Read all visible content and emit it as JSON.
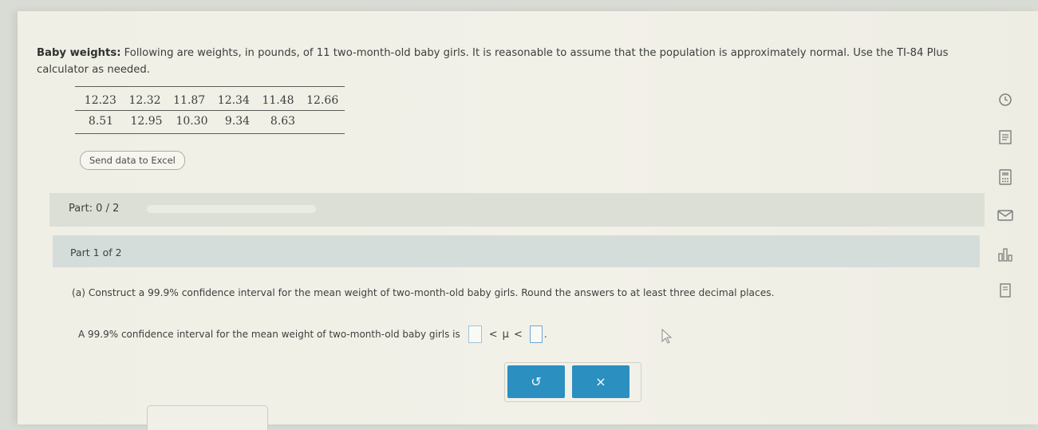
{
  "question": {
    "title": "Baby weights:",
    "body": " Following are weights, in pounds, of 11 two-month-old baby girls. It is reasonable to assume that the population is approximately normal. Use the TI-84 Plus calculator as needed."
  },
  "data_table": {
    "rows": [
      [
        "12.23",
        "12.32",
        "11.87",
        "12.34",
        "11.48",
        "12.66"
      ],
      [
        "8.51",
        "12.95",
        "10.30",
        "9.34",
        "8.63"
      ]
    ]
  },
  "excel_button": {
    "label": "Send data to Excel"
  },
  "parts": {
    "label": "Part: 0 / 2",
    "progress": 0
  },
  "part1": {
    "label": "Part 1 of 2"
  },
  "instruction": "(a) Construct a 99.9% confidence interval for the mean weight of two-month-old baby girls. Round the answers to at least three decimal places.",
  "answer": {
    "prefix": "A 99.9% confidence interval for the mean weight of two-month-old baby girls is",
    "lt1": "<",
    "mu": "μ",
    "lt2": "<",
    "suffix": "."
  },
  "buttons": {
    "undo": "↺",
    "clear": "×"
  },
  "colors": {
    "accent": "#2b8fc0",
    "progress": "#6aa5d3"
  },
  "icons": [
    "clock-icon",
    "list-icon",
    "calculator-icon",
    "mail-icon",
    "chart-icon",
    "book-icon"
  ]
}
